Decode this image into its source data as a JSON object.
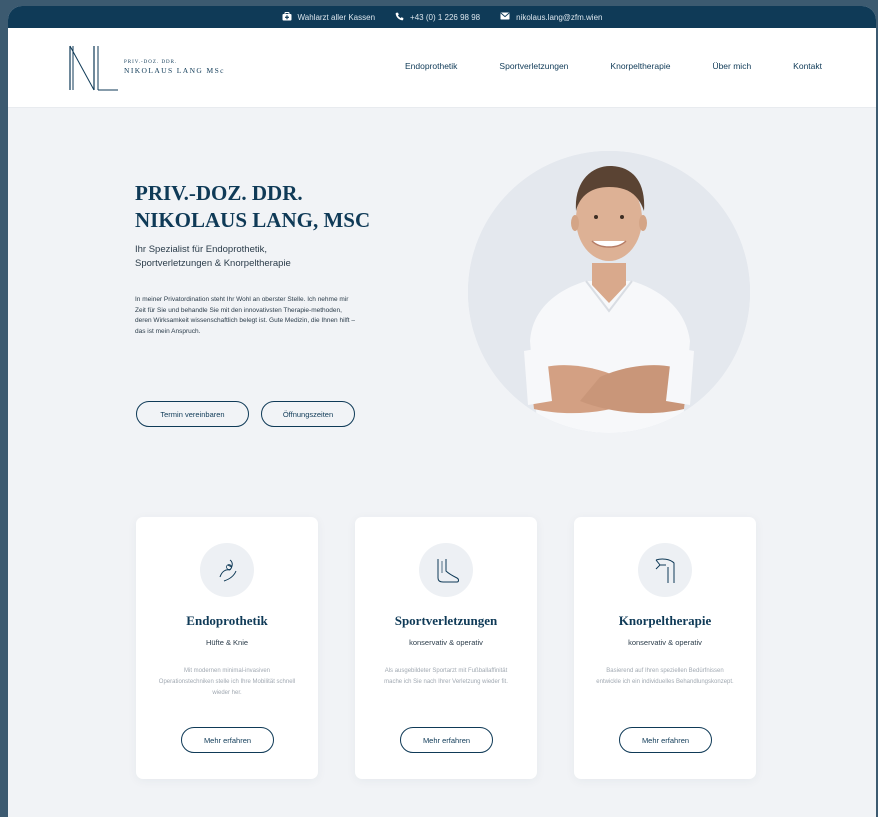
{
  "topbar": {
    "insurance": "Wahlarzt aller Kassen",
    "phone": "+43 (0) 1 226 98 98",
    "email": "nikolaus.lang@zfm.wien"
  },
  "logo": {
    "monogram": "NL",
    "prefix": "PRIV.-DOZ. DDR.",
    "name": "NIKOLAUS LANG MSc"
  },
  "nav": {
    "items": [
      "Endoprothetik",
      "Sportverletzungen",
      "Knorpeltherapie",
      "Über mich",
      "Kontakt"
    ]
  },
  "hero": {
    "title_line1": "PRIV.-DOZ. DDR.",
    "title_line2": "NIKOLAUS LANG, MSC",
    "subtitle_line1": "Ihr Spezialist für Endoprothetik,",
    "subtitle_line2": "Sportverletzungen & Knorpeltherapie",
    "text": "In meiner Privatordination steht Ihr Wohl an oberster Stelle. Ich nehme mir Zeit für Sie und behandle Sie mit den innovativsten Therapie-methoden, deren Wirksamkeit wissenschaftlich belegt ist. Gute Medizin, die Ihnen hilft – das ist mein Anspruch.",
    "button_primary": "Termin vereinbaren",
    "button_secondary": "Öffnungszeiten"
  },
  "cards": [
    {
      "icon": "knee-joint-icon",
      "title": "Endoprothetik",
      "subtitle": "Hüfte & Knie",
      "text": "Mit modernen minimal-invasiven Operationstechniken stelle ich Ihre Mobilität schnell wieder her.",
      "button": "Mehr erfahren"
    },
    {
      "icon": "foot-icon",
      "title": "Sportverletzungen",
      "subtitle": "konservativ & operativ",
      "text": "Als ausgebildeter Sportarzt mit Fußballaffinität mache ich Sie nach Ihrer Verletzung wieder fit.",
      "button": "Mehr erfahren"
    },
    {
      "icon": "joint-cartilage-icon",
      "title": "Knorpeltherapie",
      "subtitle": "konservativ & operativ",
      "text": "Basierend auf Ihren speziellen Bedürfnissen entwickle ich ein individuelles Behandlungskonzept.",
      "button": "Mehr erfahren"
    }
  ],
  "colors": {
    "primary": "#0f3a57",
    "background": "#f1f3f6",
    "card": "#ffffff",
    "muted_text": "#a1a9b2"
  }
}
